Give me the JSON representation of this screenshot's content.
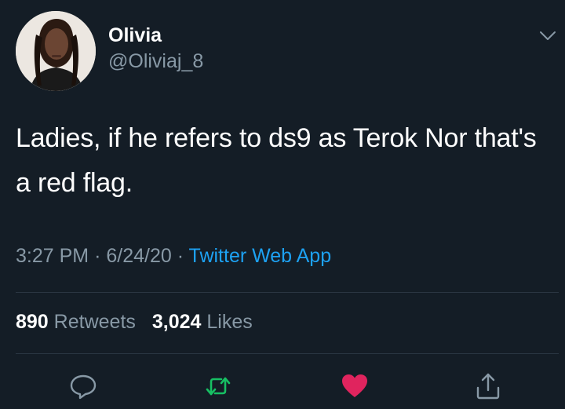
{
  "user": {
    "display_name": "Olivia",
    "handle": "@Oliviaj_8"
  },
  "tweet": {
    "text": "Ladies, if he refers to ds9 as Terok Nor that's a red flag.",
    "time": "3:27 PM",
    "separator": "·",
    "date": "6/24/20",
    "source": "Twitter Web App"
  },
  "stats": {
    "retweets_count": "890",
    "retweets_label": "Retweets",
    "likes_count": "3,024",
    "likes_label": "Likes"
  },
  "icons": {
    "menu": "chevron-down-icon",
    "reply": "reply-icon",
    "retweet": "retweet-icon",
    "like": "heart-icon",
    "share": "share-icon"
  },
  "colors": {
    "background": "#141d26",
    "secondary_text": "#8899a6",
    "link": "#1da1f2",
    "retweet": "#17bf63",
    "like": "#e0245e"
  }
}
